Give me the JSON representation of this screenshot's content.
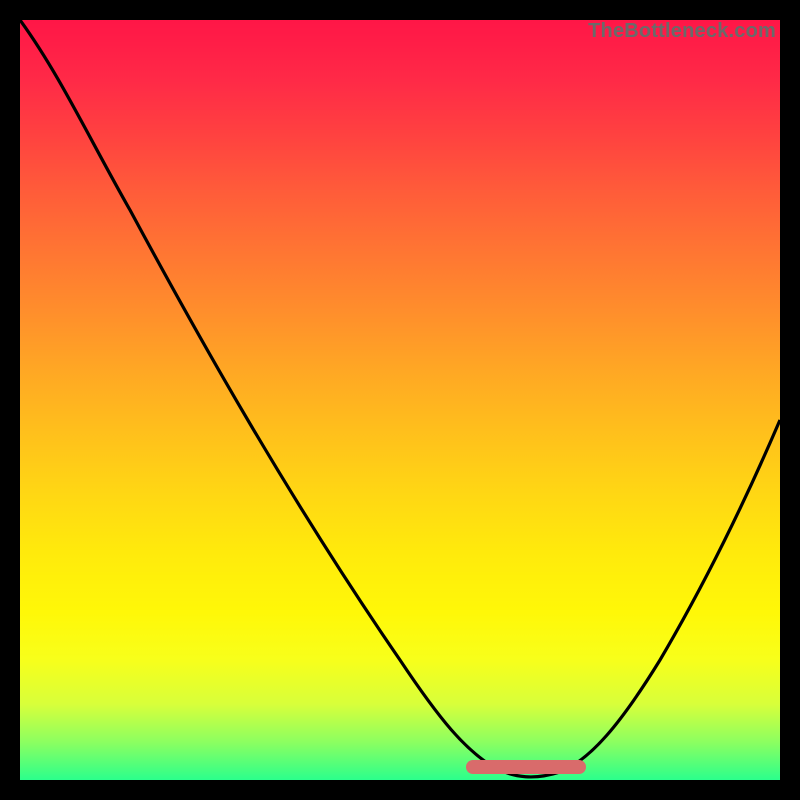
{
  "watermark": "TheBottleneck.com",
  "colors": {
    "background": "#000000",
    "curve": "#000000",
    "accent": "#d96b6b",
    "gradient_top": "#ff1647",
    "gradient_bottom": "#2bff8c"
  },
  "chart_data": {
    "type": "line",
    "title": "",
    "xlabel": "",
    "ylabel": "",
    "xlim": [
      0,
      100
    ],
    "ylim": [
      0,
      100
    ],
    "series": [
      {
        "name": "bottleneck-curve",
        "x": [
          0,
          5,
          10,
          15,
          20,
          25,
          30,
          35,
          40,
          45,
          50,
          55,
          60,
          65,
          68,
          72,
          75,
          80,
          85,
          90,
          95,
          100
        ],
        "values": [
          100,
          96,
          90,
          82,
          74,
          66,
          58,
          50,
          42,
          34,
          26,
          18,
          10,
          4,
          1,
          1,
          3,
          10,
          20,
          32,
          44,
          56
        ]
      }
    ],
    "accent_segment": {
      "x_start": 60,
      "x_end": 74,
      "y": 2
    },
    "notes": "V-shaped bottleneck curve over cold-to-hot gradient background; minimum around x≈70. No axis ticks or labels visible."
  }
}
